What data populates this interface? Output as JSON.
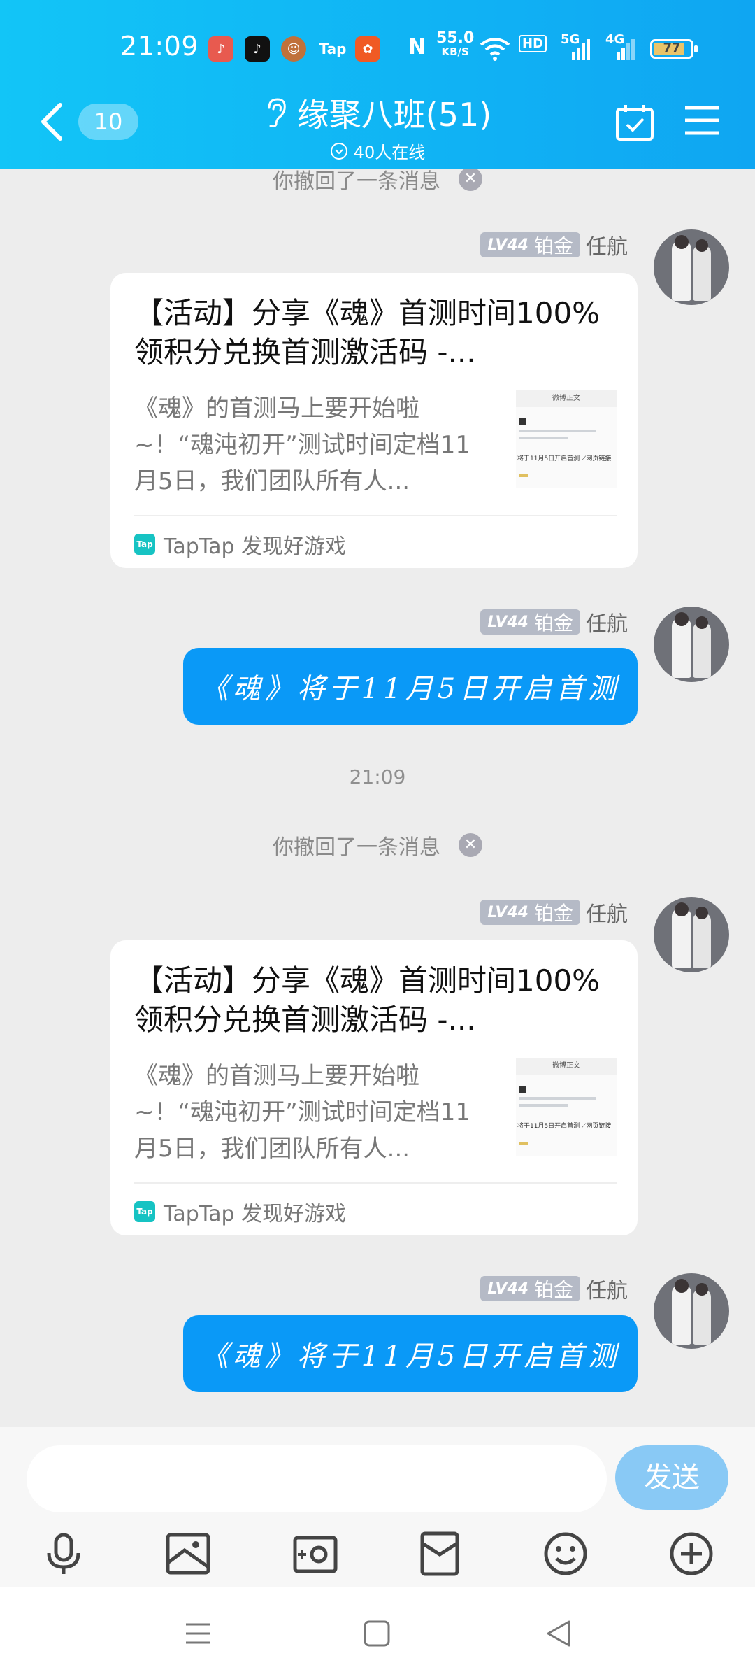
{
  "status_bar": {
    "time": "21:09",
    "speed_value": "55.0",
    "speed_unit": "KB/S",
    "nfc": "N",
    "hd": "HD",
    "net1": "5G",
    "net2": "4G",
    "battery": "77",
    "app_icons": [
      "music-app-icon",
      "tiktok-icon",
      "game-avatar-icon",
      "taptap-icon",
      "kuaishou-icon"
    ],
    "tap_label": "Tap"
  },
  "header": {
    "unread_count": "10",
    "title": "缘聚八班(51)",
    "online": "40人在线",
    "colors": {
      "gradient_start": "#12c5f7",
      "gradient_end": "#0fa6f2"
    }
  },
  "messages": {
    "recall_1": "你撤回了一条消息",
    "recall_2": "你撤回了一条消息",
    "timestamp": "21:09",
    "sender": {
      "level": "LV44",
      "tier": "铂金",
      "name": "任航"
    },
    "card": {
      "title": "【活动】分享《魂》首测时间100%领积分兑换首测激活码 -...",
      "desc": "《魂》的首测马上要开始啦~！“魂沌初开”测试时间定档11月5日，我们团队所有人...",
      "source": "TapTap 发现好游戏",
      "source_icon_label": "Tap",
      "thumb_header": "微博正文",
      "thumb_text": "将于11月5日开启首测 ⟋网页链接"
    },
    "bubble_text": "《魂》将于11月5日开启首测",
    "bubble_color": "#0a99f7"
  },
  "input": {
    "placeholder": "",
    "send_label": "发送"
  }
}
